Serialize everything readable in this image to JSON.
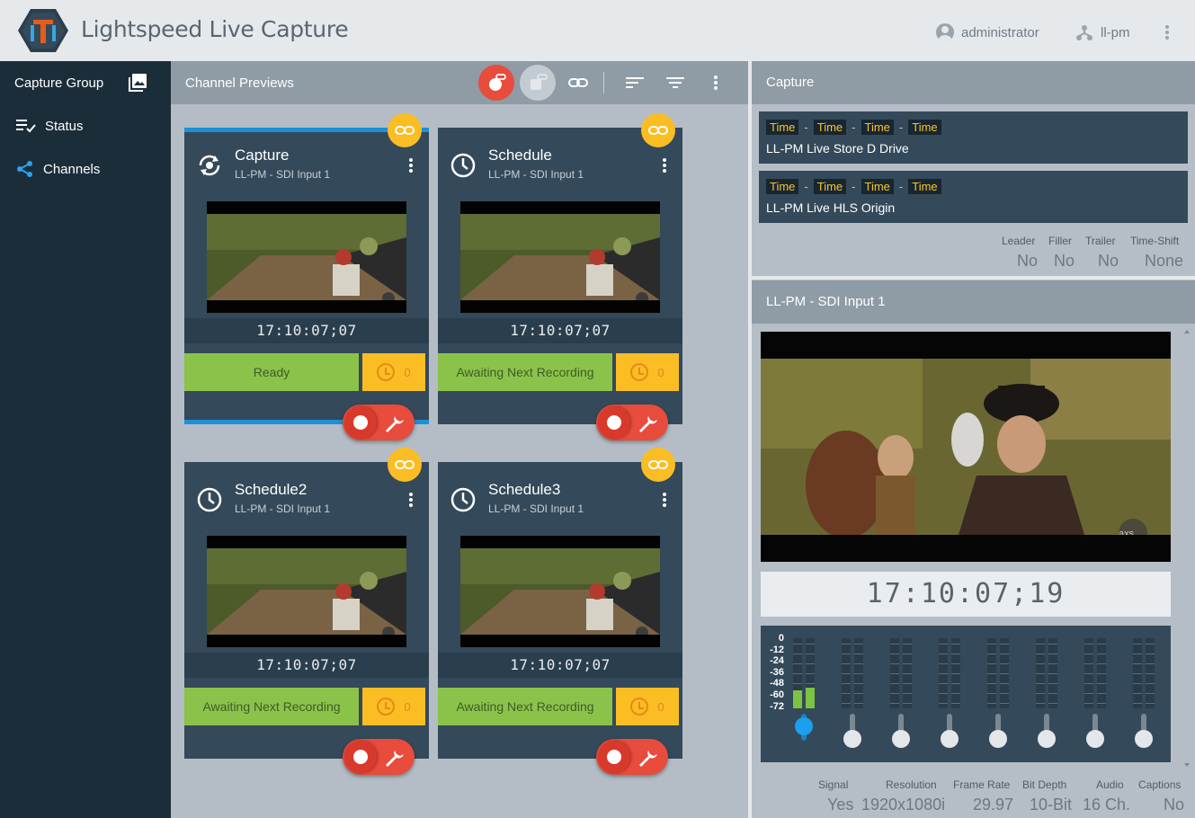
{
  "header": {
    "title": "Lightspeed Live Capture",
    "user": "administrator",
    "node": "ll-pm"
  },
  "sidebar": {
    "group_title": "Capture Group",
    "items": [
      {
        "label": "Status",
        "icon": "status-list-icon"
      },
      {
        "label": "Channels",
        "icon": "share-nodes-icon"
      }
    ]
  },
  "previews": {
    "title": "Channel Previews",
    "cards": [
      {
        "title": "Capture",
        "sub": "LL-PM - SDI Input 1",
        "timecode": "17:10:07;07",
        "status": "Ready",
        "count": "0",
        "icon": "sync-icon",
        "selected": true
      },
      {
        "title": "Schedule",
        "sub": "LL-PM - SDI Input 1",
        "timecode": "17:10:07;07",
        "status": "Awaiting Next Recording",
        "count": "0",
        "icon": "clock-icon",
        "selected": false
      },
      {
        "title": "Schedule2",
        "sub": "LL-PM - SDI Input 1",
        "timecode": "17:10:07;07",
        "status": "Awaiting Next Recording",
        "count": "0",
        "icon": "clock-icon",
        "selected": false
      },
      {
        "title": "Schedule3",
        "sub": "LL-PM - SDI Input 1",
        "timecode": "17:10:07;07",
        "status": "Awaiting Next Recording",
        "count": "0",
        "icon": "clock-icon",
        "selected": false
      }
    ]
  },
  "capture": {
    "title": "Capture",
    "time_label": "Time",
    "destinations": [
      {
        "name": "LL-PM Live Store D Drive"
      },
      {
        "name": "LL-PM Live HLS Origin"
      }
    ],
    "info": [
      {
        "label": "Leader",
        "value": "No"
      },
      {
        "label": "Filler",
        "value": "No"
      },
      {
        "label": "Trailer",
        "value": "No"
      },
      {
        "label": "Time-Shift",
        "value": "None"
      }
    ]
  },
  "input": {
    "title": "LL-PM - SDI Input 1",
    "timecode": "17:10:07;19",
    "scale": [
      "0",
      "-12",
      "-24",
      "-36",
      "-48",
      "-60",
      "-72"
    ],
    "levels": [
      0.25,
      0.3,
      0,
      0,
      0,
      0,
      0,
      0,
      0,
      0,
      0,
      0,
      0,
      0,
      0,
      0
    ],
    "signal": [
      {
        "label": "Signal",
        "value": "Yes"
      },
      {
        "label": "Resolution",
        "value": "1920x1080i"
      },
      {
        "label": "Frame Rate",
        "value": "29.97"
      },
      {
        "label": "Bit Depth",
        "value": "10-Bit"
      },
      {
        "label": "Audio",
        "value": "16 Ch."
      },
      {
        "label": "Captions",
        "value": "No"
      }
    ]
  },
  "colors": {
    "accent": "#1e90d8",
    "record": "#e74c3c",
    "link": "#fbbd24",
    "ready": "#8bc34a",
    "timecode_text": "#f7c52d"
  }
}
